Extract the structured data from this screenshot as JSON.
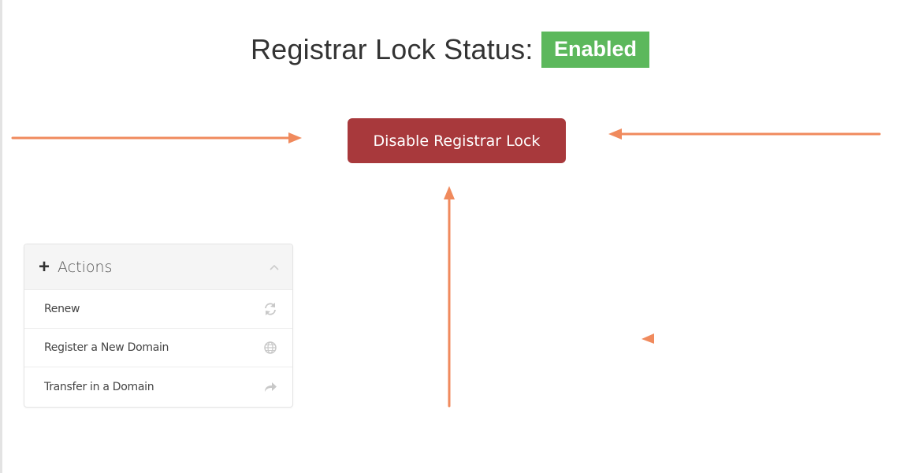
{
  "status": {
    "label": "Registrar Lock Status:",
    "value": "Enabled",
    "value_color": "#5cb85c"
  },
  "lock_button": {
    "label": "Disable Registrar Lock",
    "color": "#a8393c"
  },
  "actions_panel": {
    "title": "Actions",
    "header_icon": "plus-icon",
    "collapse_icon": "chevron-up-icon",
    "items": [
      {
        "label": "Renew",
        "icon": "refresh-icon"
      },
      {
        "label": "Register a New Domain",
        "icon": "globe-icon"
      },
      {
        "label": "Transfer in a Domain",
        "icon": "share-arrow-icon"
      }
    ]
  },
  "annotation_color": "#f08a5d"
}
